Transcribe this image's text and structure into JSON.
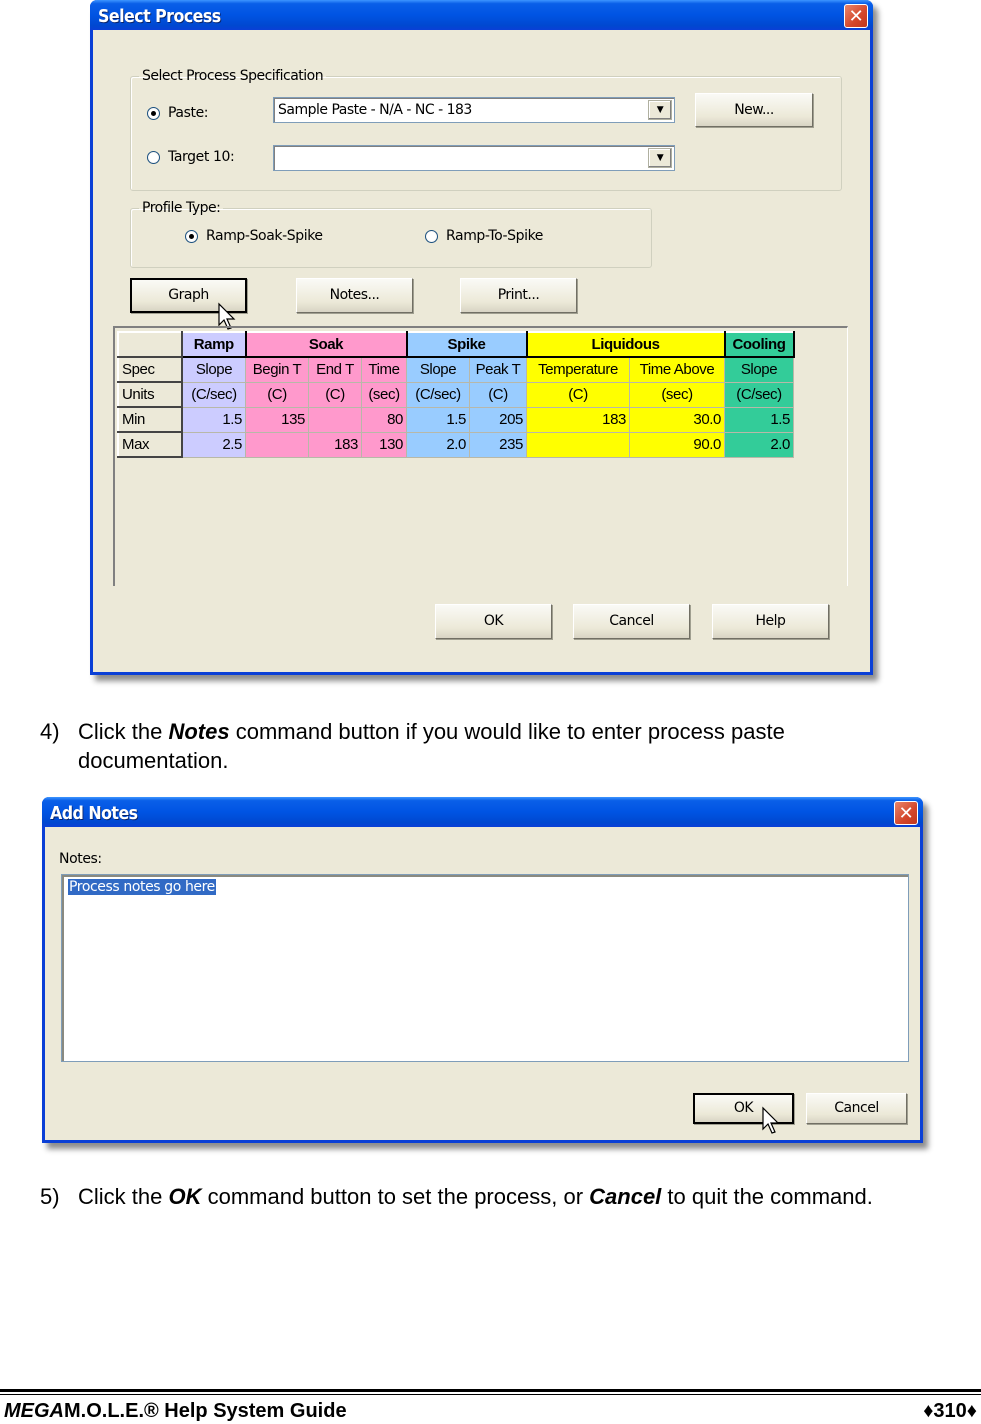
{
  "select_process_dialog": {
    "title": "Select Process",
    "close_icon": "close-x-icon",
    "spec_group_label": "Select Process Specification",
    "paste_radio": {
      "label": "Paste:",
      "checked": true
    },
    "paste_combo_value": "Sample Paste - N/A - NC - 183",
    "target_radio": {
      "label": "Target 10:",
      "checked": false
    },
    "target_combo_value": "",
    "new_button": "New...",
    "profile_group_label": "Profile Type:",
    "profile_options": [
      {
        "label": "Ramp-Soak-Spike",
        "checked": true
      },
      {
        "label": "Ramp-To-Spike",
        "checked": false
      }
    ],
    "graph_button": "Graph",
    "notes_button": "Notes...",
    "print_button": "Print...",
    "table": {
      "groups": [
        "Ramp",
        "Soak",
        "Spike",
        "Liquidous",
        "Cooling"
      ],
      "spec_row_label": "Spec",
      "units_row_label": "Units",
      "min_row_label": "Min",
      "max_row_label": "Max",
      "columns": [
        {
          "group": "Ramp",
          "spec": "Slope",
          "units": "(C/sec)",
          "min": "1.5",
          "max": "2.5"
        },
        {
          "group": "Soak",
          "spec": "Begin T",
          "units": "(C)",
          "min": "135",
          "max": ""
        },
        {
          "group": "Soak",
          "spec": "End T",
          "units": "(C)",
          "min": "",
          "max": "183"
        },
        {
          "group": "Soak",
          "spec": "Time",
          "units": "(sec)",
          "min": "80",
          "max": "130"
        },
        {
          "group": "Spike",
          "spec": "Slope",
          "units": "(C/sec)",
          "min": "1.5",
          "max": "2.0"
        },
        {
          "group": "Spike",
          "spec": "Peak T",
          "units": "(C)",
          "min": "205",
          "max": "235"
        },
        {
          "group": "Liquidous",
          "spec": "Temperature",
          "units": "(C)",
          "min": "183",
          "max": ""
        },
        {
          "group": "Liquidous",
          "spec": "Time Above",
          "units": "(sec)",
          "min": "30.0",
          "max": "90.0"
        },
        {
          "group": "Cooling",
          "spec": "Slope",
          "units": "(C/sec)",
          "min": "1.5",
          "max": "2.0"
        }
      ],
      "group_colors": {
        "Ramp": "#ccccff",
        "Soak": "#ff99cc",
        "Spike": "#99ccff",
        "Liquidous": "#ffff00",
        "Cooling": "#33cc99"
      }
    },
    "ok_button": "OK",
    "cancel_button": "Cancel",
    "help_button": "Help"
  },
  "step4": {
    "number": "4)",
    "prefix": "Click the ",
    "emphasis": "Notes",
    "suffix": " command button if you would like to enter process paste documentation."
  },
  "add_notes_dialog": {
    "title": "Add Notes",
    "close_icon": "close-x-icon",
    "notes_label": "Notes:",
    "notes_value": "Process notes go here",
    "ok_button": "OK",
    "cancel_button": "Cancel"
  },
  "step5": {
    "number": "5)",
    "prefix": "Click the ",
    "emphasis1": "OK",
    "middle": " command button to set the process, or ",
    "emphasis2": "Cancel",
    "suffix": " to quit the command."
  },
  "footer": {
    "brand_italic": "MEGA",
    "brand_rest": "M.O.L.E.® Help System Guide",
    "page": "♦310♦"
  }
}
